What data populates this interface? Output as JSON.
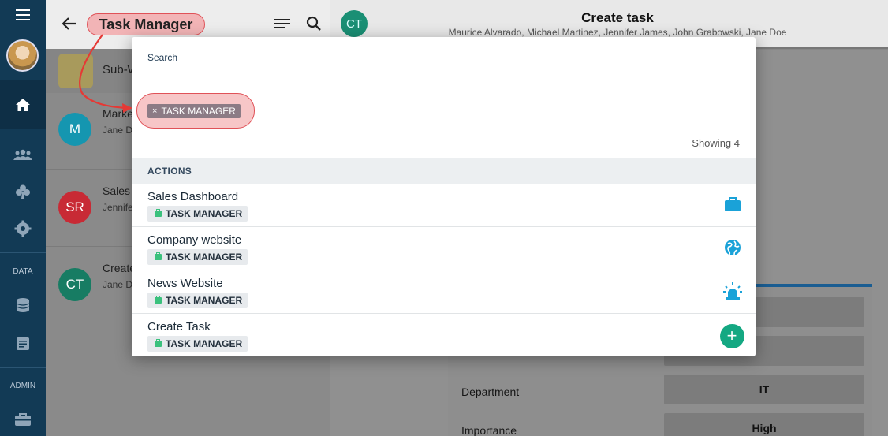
{
  "sidebar": {
    "section_data": "DATA",
    "section_admin": "ADMIN"
  },
  "app": {
    "title": "Task Manager",
    "sub_item": "Sub-W",
    "rows": [
      {
        "initials": "M",
        "title": "Marke",
        "subtitle": "Jane D",
        "color": "#1596b0"
      },
      {
        "initials": "SR",
        "title": "Sales",
        "subtitle": "Jennife",
        "color": "#c82a35"
      },
      {
        "initials": "CT",
        "title": "Create",
        "subtitle": "Jane D",
        "color": "#177c63"
      }
    ]
  },
  "task": {
    "avatar": "CT",
    "title": "Create task",
    "participants": "Maurice Alvarado, Michael Martinez, Jennifer James, John Grabowski, Jane Doe",
    "fields": [
      {
        "label": "Department",
        "value": "IT"
      },
      {
        "label": "Importance",
        "value": "High"
      }
    ]
  },
  "modal": {
    "search_label": "Search",
    "search_value": "",
    "chip": "TASK MANAGER",
    "chip_remove": "×",
    "showing": "Showing 4",
    "section": "ACTIONS",
    "actions": [
      {
        "title": "Sales Dashboard",
        "tag": "TASK MANAGER",
        "icon": "briefcase-icon"
      },
      {
        "title": "Company website",
        "tag": "TASK MANAGER",
        "icon": "globe-icon"
      },
      {
        "title": "News Website",
        "tag": "TASK MANAGER",
        "icon": "siren-icon"
      },
      {
        "title": "Create Task",
        "tag": "TASK MANAGER",
        "icon": "add-icon"
      }
    ]
  },
  "colors": {
    "accent": "#1aa2d8",
    "highlight": "#e05258",
    "tag_green": "#3bc17d",
    "add_button": "#14a882"
  }
}
